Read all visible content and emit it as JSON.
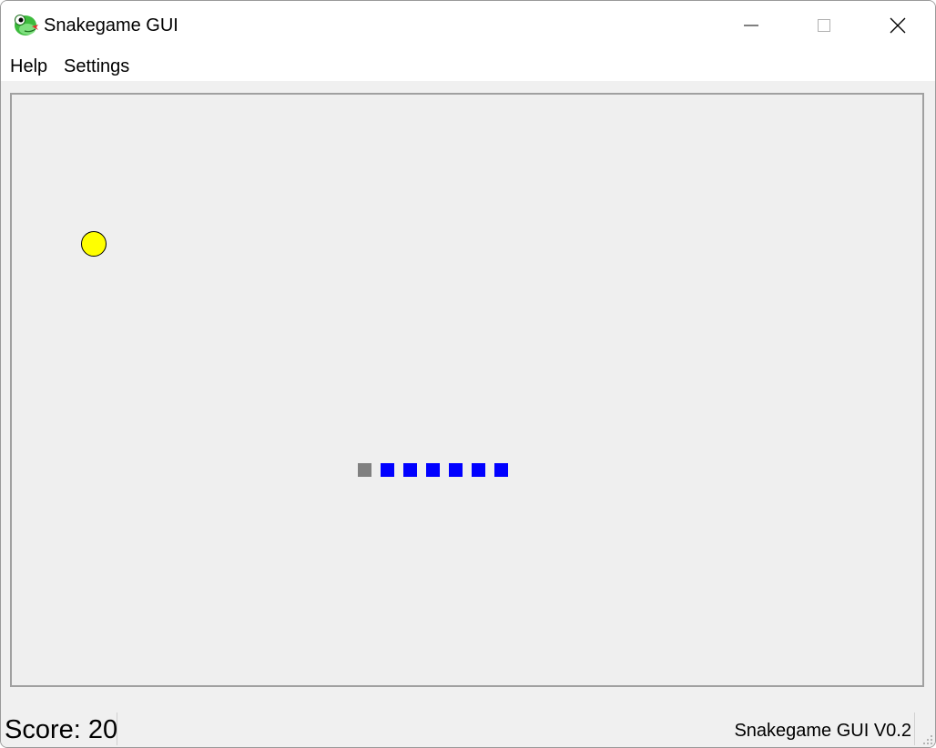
{
  "window": {
    "title": "Snakegame GUI",
    "app_icon": "snake-icon",
    "controls": {
      "minimize": "minimize-icon",
      "maximize": "maximize-icon",
      "close": "close-icon"
    }
  },
  "menu": {
    "items": [
      "Help",
      "Settings"
    ]
  },
  "game": {
    "food_color": "#ffff00",
    "snake_head_color": "#808080",
    "snake_body_color": "#0000ff",
    "board_background": "#efefef",
    "snake_length": 7
  },
  "status": {
    "score": "Score: 20",
    "version": "Snakegame GUI V0.2"
  }
}
